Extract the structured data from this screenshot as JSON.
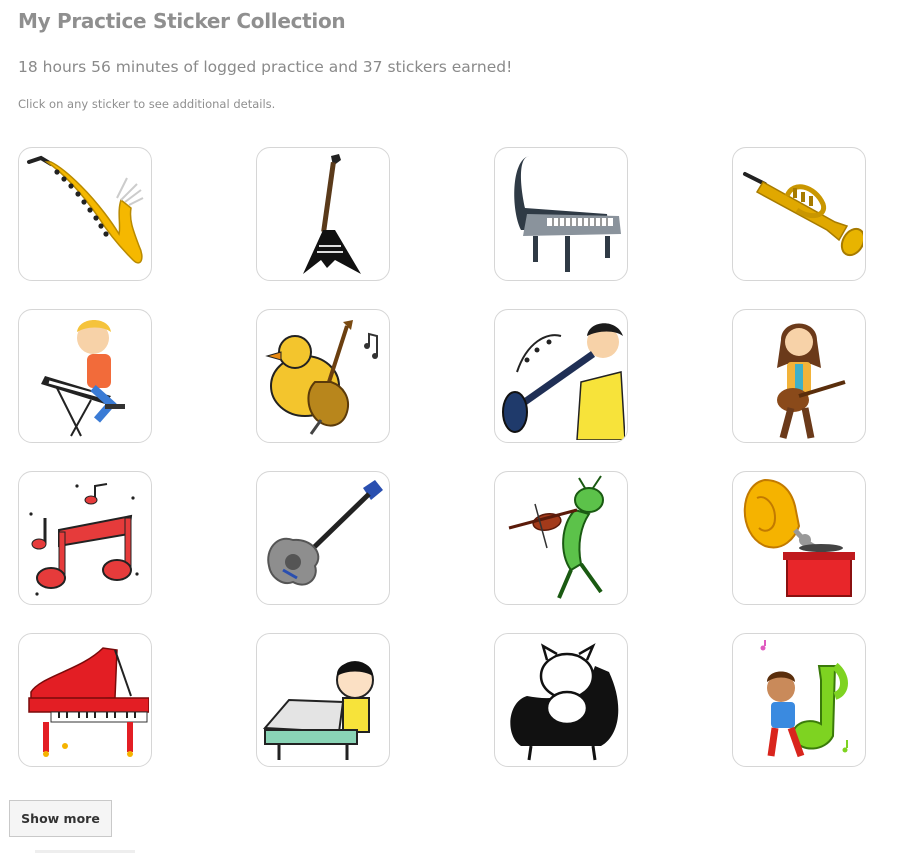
{
  "page": {
    "title": "My Practice Sticker Collection",
    "summary": "18 hours 56 minutes of logged practice and 37 stickers earned!",
    "hint": "Click on any sticker to see additional details."
  },
  "stickers": [
    {
      "icon": "saxophone-icon"
    },
    {
      "icon": "electric-guitar-icon"
    },
    {
      "icon": "grand-piano-icon"
    },
    {
      "icon": "trumpet-icon"
    },
    {
      "icon": "boy-playing-keyboard-icon"
    },
    {
      "icon": "bird-playing-cello-icon"
    },
    {
      "icon": "boy-playing-clarinet-icon"
    },
    {
      "icon": "girl-playing-guitar-icon"
    },
    {
      "icon": "music-notes-icon"
    },
    {
      "icon": "acoustic-guitar-icon"
    },
    {
      "icon": "grasshopper-playing-violin-icon"
    },
    {
      "icon": "gramophone-icon"
    },
    {
      "icon": "red-grand-piano-icon"
    },
    {
      "icon": "boy-playing-piano-icon"
    },
    {
      "icon": "cat-in-armchair-icon"
    },
    {
      "icon": "boy-with-music-note-icon"
    }
  ],
  "actions": {
    "show_more_label": "Show more"
  },
  "colors": {
    "card_border": "#d6d6d6",
    "text": "#8a8a8a",
    "button_bg": "#f5f5f5"
  }
}
